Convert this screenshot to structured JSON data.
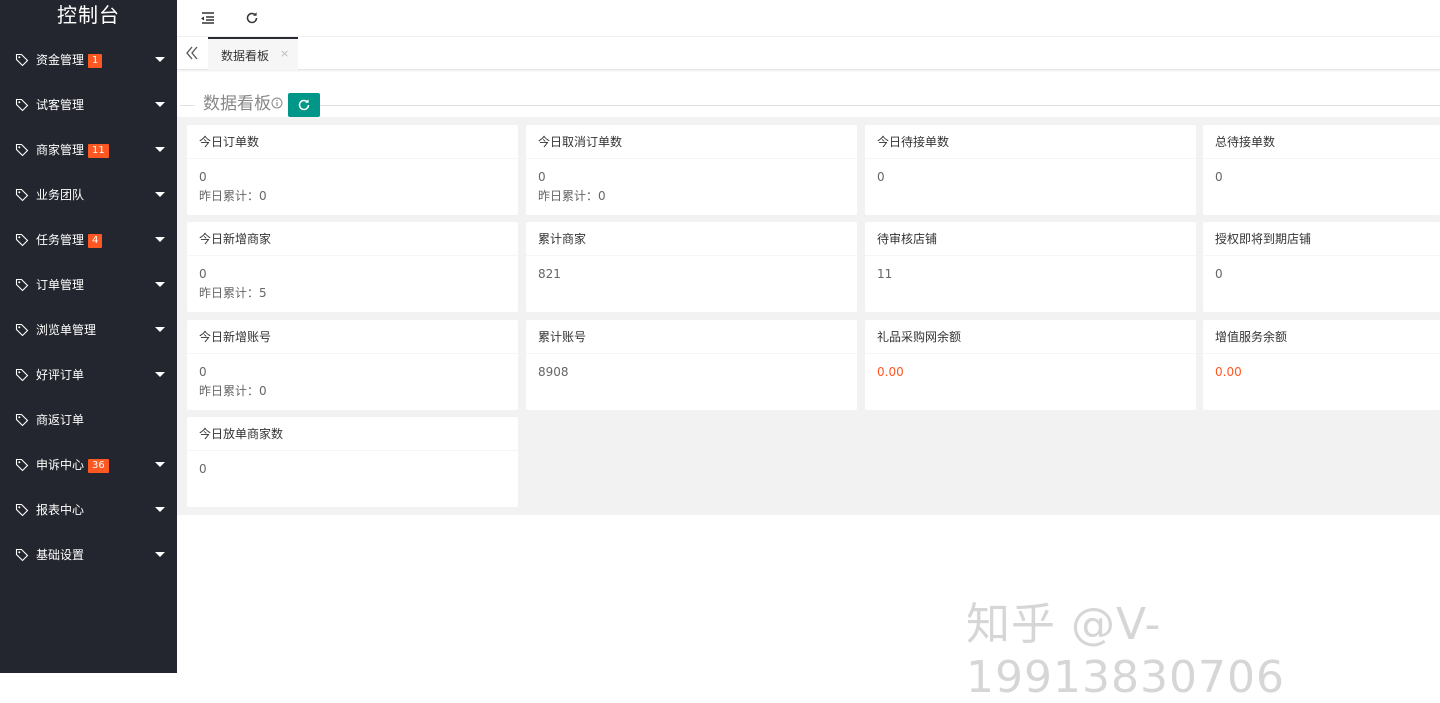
{
  "sidebar": {
    "title": "控制台",
    "items": [
      {
        "label": "资金管理",
        "badge": "1"
      },
      {
        "label": "试客管理",
        "badge": ""
      },
      {
        "label": "商家管理",
        "badge": "11"
      },
      {
        "label": "业务团队",
        "badge": ""
      },
      {
        "label": "任务管理",
        "badge": "4"
      },
      {
        "label": "订单管理",
        "badge": ""
      },
      {
        "label": "浏览单管理",
        "badge": ""
      },
      {
        "label": "好评订单",
        "badge": ""
      },
      {
        "label": "商返订单",
        "badge": ""
      },
      {
        "label": "申诉中心",
        "badge": "36"
      },
      {
        "label": "报表中心",
        "badge": ""
      },
      {
        "label": "基础设置",
        "badge": ""
      }
    ]
  },
  "tabs": [
    {
      "label": "数据看板",
      "close": "×"
    }
  ],
  "panel": {
    "title": "数据看板"
  },
  "cards": [
    {
      "title": "今日订单数",
      "value": "0",
      "sub": "昨日累计：0"
    },
    {
      "title": "今日取消订单数",
      "value": "0",
      "sub": "昨日累计：0"
    },
    {
      "title": "今日待接单数",
      "value": "0",
      "sub": ""
    },
    {
      "title": "总待接单数",
      "value": "0",
      "sub": ""
    },
    {
      "title": "今日新增商家",
      "value": "0",
      "sub": "昨日累计：5"
    },
    {
      "title": "累计商家",
      "value": "821",
      "sub": ""
    },
    {
      "title": "待审核店铺",
      "value": "11",
      "sub": ""
    },
    {
      "title": "授权即将到期店铺",
      "value": "0",
      "sub": ""
    },
    {
      "title": "今日新增账号",
      "value": "0",
      "sub": "昨日累计：0"
    },
    {
      "title": "累计账号",
      "value": "8908",
      "sub": ""
    },
    {
      "title": "礼品采购网余额",
      "value": "0.00",
      "sub": ""
    },
    {
      "title": "增值服务余额",
      "value": "0.00",
      "sub": ""
    },
    {
      "title": "今日放单商家数",
      "value": "0",
      "sub": ""
    }
  ],
  "watermark": "知乎 @V-19913830706",
  "colors": {
    "sidebar": "#23262e",
    "accent": "#009688",
    "badge": "#ff5722",
    "money": "#ff5722"
  }
}
